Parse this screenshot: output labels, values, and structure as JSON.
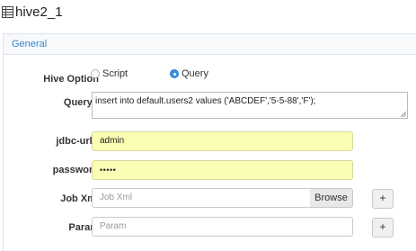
{
  "window": {
    "title": "hive2_1"
  },
  "panel": {
    "header": "General"
  },
  "form": {
    "hive_option": {
      "label": "Hive Option",
      "options": [
        "Script",
        "Query"
      ],
      "selected": "Query"
    },
    "query": {
      "label": "Query",
      "required_mark": "*",
      "value": "insert into default.users2 values ('ABCDEF','5-5-88','F');"
    },
    "jdbc_url": {
      "label": "jdbc-url",
      "required_mark": "*",
      "value": "admin"
    },
    "password": {
      "label": "password",
      "value": "•••••"
    },
    "job_xml": {
      "label": "Job Xml",
      "placeholder": "Job Xml",
      "browse_label": "Browse",
      "add_label": "+"
    },
    "param": {
      "label": "Param",
      "placeholder": "Param",
      "add_label": "+"
    }
  },
  "colors": {
    "accent": "#3a87c8",
    "required": "#d9534f",
    "highlight_field": "#fbfdb4"
  }
}
